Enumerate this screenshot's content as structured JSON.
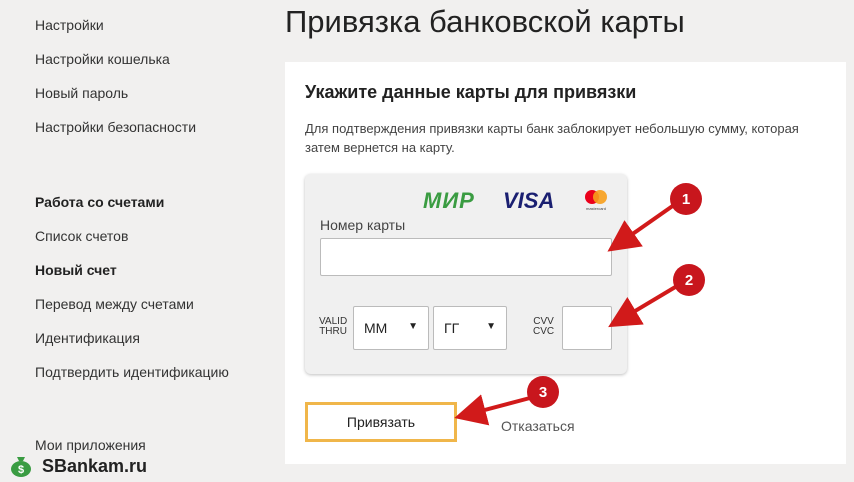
{
  "sidebar": {
    "items_top": [
      "Настройки",
      "Настройки кошелька",
      "Новый пароль",
      "Настройки безопасности"
    ],
    "section_heading": "Работа со счетами",
    "items_accounts": [
      "Список счетов",
      "Новый счет",
      "Перевод между счетами",
      "Идентификация",
      "Подтвердить идентификацию"
    ],
    "apps": "Мои приложения"
  },
  "page": {
    "title": "Привязка банковской карты"
  },
  "form": {
    "heading": "Укажите данные карты для привязки",
    "description": "Для подтверждения привязки карты банк заблокирует небольшую сумму, которая затем вернется на карту.",
    "logos": {
      "mir": "МИР",
      "visa": "VISA",
      "mastercard": "mastercard"
    },
    "card_number_label": "Номер карты",
    "card_number_value": "",
    "valid_thru_line1": "VALID",
    "valid_thru_line2": "THRU",
    "month_select": "ММ",
    "year_select": "ГГ",
    "cvv_line1": "CVV",
    "cvv_line2": "CVC",
    "cvv_value": "",
    "submit_label": "Привязать",
    "cancel_label": "Отказаться"
  },
  "annotations": [
    "1",
    "2",
    "3"
  ],
  "watermark": "SBankam.ru",
  "colors": {
    "background": "#f1f0ef",
    "panel": "#ffffff",
    "button_border": "#f0b64a",
    "arrow_red": "#d11a1a",
    "mir_green": "#3a9c42",
    "visa_blue": "#1a1f71"
  }
}
